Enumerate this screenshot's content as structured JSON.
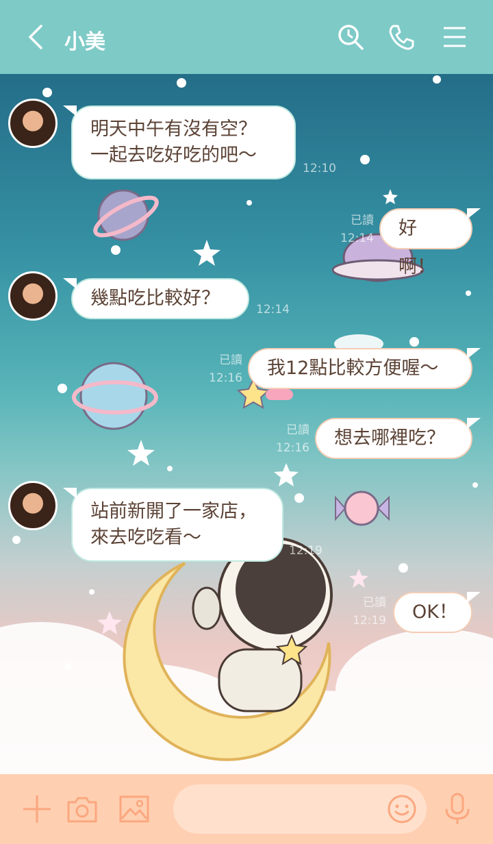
{
  "header": {
    "title": "小美",
    "back_icon": "chevron-left-icon",
    "search_icon": "search-icon",
    "call_icon": "phone-icon",
    "menu_icon": "hamburger-menu-icon"
  },
  "messages": [
    {
      "side": "left",
      "lines": [
        "明天中午有沒有空？",
        "一起去吃好吃的吧～"
      ],
      "time": "12:10"
    },
    {
      "side": "right",
      "lines": [
        "好啊！"
      ],
      "read": "已讀",
      "time": "12:14"
    },
    {
      "side": "left",
      "lines": [
        "幾點吃比較好？"
      ],
      "time": "12:14"
    },
    {
      "side": "right",
      "lines": [
        "我12點比較方便喔～"
      ],
      "read": "已讀",
      "time": "12:16"
    },
    {
      "side": "right",
      "lines": [
        "想去哪裡吃？"
      ],
      "read": "已讀",
      "time": "12:16"
    },
    {
      "side": "left",
      "lines": [
        "站前新開了一家店，",
        "來去吃吃看～"
      ],
      "time": "12:19"
    },
    {
      "side": "right",
      "lines": [
        "OK！"
      ],
      "read": "已讀",
      "time": "12:19"
    }
  ],
  "footer": {
    "add_icon": "plus-icon",
    "camera_icon": "camera-icon",
    "image_icon": "image-icon",
    "emoji_icon": "smiley-icon",
    "mic_icon": "microphone-icon",
    "input_value": ""
  },
  "colors": {
    "header": "#7ecac7",
    "footer": "#ffcfb1",
    "text": "#5b4235"
  }
}
